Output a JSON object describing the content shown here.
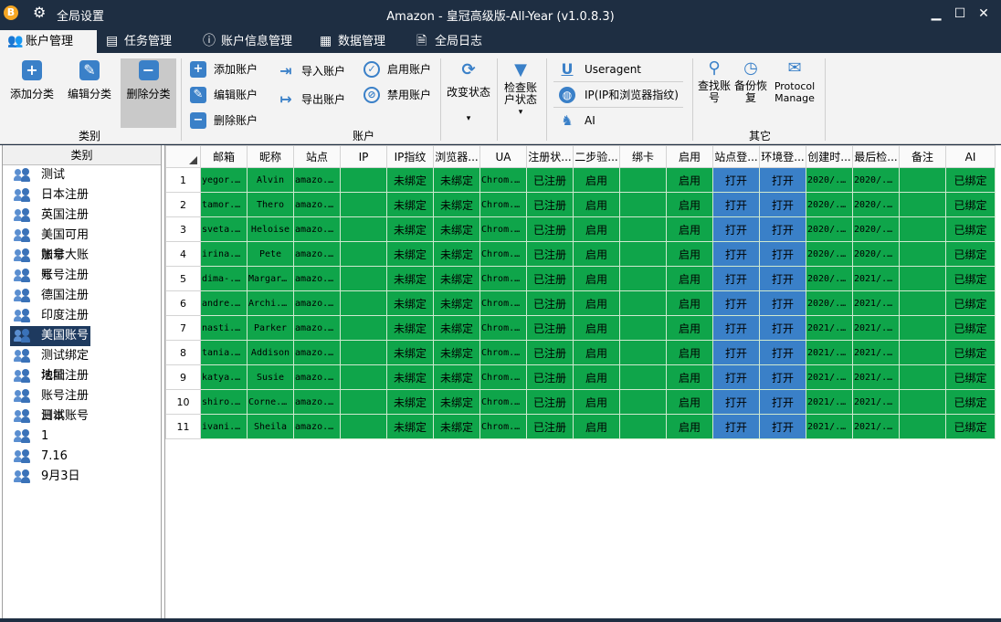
{
  "titlebar": {
    "logo": "B",
    "settings_label": "全局设置",
    "title": "Amazon - 皇冠高级版-All-Year  (v1.0.8.3)"
  },
  "tabs": [
    {
      "label": "账户管理",
      "icon": "users-icon"
    },
    {
      "label": "任务管理",
      "icon": "list-icon"
    },
    {
      "label": "账户信息管理",
      "icon": "info-icon"
    },
    {
      "label": "数据管理",
      "icon": "grid-icon"
    },
    {
      "label": "全局日志",
      "icon": "document-icon"
    }
  ],
  "ribbon": {
    "category_group": {
      "label": "类别",
      "add": "添加分类",
      "edit": "编辑分类",
      "delete": "删除分类"
    },
    "account_group": {
      "label": "账户",
      "add": "添加账户",
      "edit": "编辑账户",
      "delete": "删除账户",
      "import": "导入账户",
      "export": "导出账户",
      "enable": "启用账户",
      "disable": "禁用账户",
      "change_status": "改变状态",
      "check_status": "检查账户状态"
    },
    "other_group": {
      "label": "其它",
      "useragent": "Useragent",
      "ip": "IP(IP和浏览器指纹)",
      "ai": "AI",
      "find": "查找账号",
      "backup": "备份恢复",
      "protocol": "Protocol Manage"
    }
  },
  "sidebar": {
    "header": "类别",
    "selected_index": 8,
    "items": [
      "测试",
      "日本注册",
      "英国注册",
      "美国可用账号",
      "加拿大账号",
      "账号注册",
      "德国注册",
      "印度注册",
      "美国账号2",
      "测试绑定地址",
      "法国注册",
      "账号注册测试",
      "日本账号",
      "1",
      "7.16",
      "9月3日"
    ]
  },
  "table": {
    "columns": [
      "邮箱",
      "昵称",
      "站点",
      "IP",
      "IP指纹",
      "浏览器...",
      "UA",
      "注册状...",
      "二步验...",
      "绑卡",
      "启用",
      "站点登...",
      "环境登...",
      "创建时...",
      "最后检...",
      "备注",
      "AI"
    ],
    "rows": [
      {
        "n": "1",
        "email": "yegor...",
        "nick": "Alvin",
        "site": "amazo...",
        "ip": "",
        "fp": "未绑定",
        "browser": "未绑定",
        "ua": "Chrom...",
        "reg": "已注册",
        "twofa": "启用",
        "card": "",
        "enabled": "启用",
        "site_login": "打开",
        "env_login": "打开",
        "created": "2020/...",
        "last": "2020/...",
        "note": "",
        "ai": "已绑定"
      },
      {
        "n": "2",
        "email": "tamor...",
        "nick": "Thero",
        "site": "amazo...",
        "ip": "",
        "fp": "未绑定",
        "browser": "未绑定",
        "ua": "Chrom...",
        "reg": "已注册",
        "twofa": "启用",
        "card": "",
        "enabled": "启用",
        "site_login": "打开",
        "env_login": "打开",
        "created": "2020/...",
        "last": "2020/...",
        "note": "",
        "ai": "已绑定"
      },
      {
        "n": "3",
        "email": "sveta...",
        "nick": "Heloise",
        "site": "amazo...",
        "ip": "",
        "fp": "未绑定",
        "browser": "未绑定",
        "ua": "Chrom...",
        "reg": "已注册",
        "twofa": "启用",
        "card": "",
        "enabled": "启用",
        "site_login": "打开",
        "env_login": "打开",
        "created": "2020/...",
        "last": "2020/...",
        "note": "",
        "ai": "已绑定"
      },
      {
        "n": "4",
        "email": "irina...",
        "nick": "Pete",
        "site": "amazo...",
        "ip": "",
        "fp": "未绑定",
        "browser": "未绑定",
        "ua": "Chrom...",
        "reg": "已注册",
        "twofa": "启用",
        "card": "",
        "enabled": "启用",
        "site_login": "打开",
        "env_login": "打开",
        "created": "2020/...",
        "last": "2020/...",
        "note": "",
        "ai": "已绑定"
      },
      {
        "n": "5",
        "email": "dima-...",
        "nick": "Margaret",
        "site": "amazo...",
        "ip": "",
        "fp": "未绑定",
        "browser": "未绑定",
        "ua": "Chrom...",
        "reg": "已注册",
        "twofa": "启用",
        "card": "",
        "enabled": "启用",
        "site_login": "打开",
        "env_login": "打开",
        "created": "2020/...",
        "last": "2021/...",
        "note": "",
        "ai": "已绑定"
      },
      {
        "n": "6",
        "email": "andre...",
        "nick": "Archi...",
        "site": "amazo...",
        "ip": "",
        "fp": "未绑定",
        "browser": "未绑定",
        "ua": "Chrom...",
        "reg": "已注册",
        "twofa": "启用",
        "card": "",
        "enabled": "启用",
        "site_login": "打开",
        "env_login": "打开",
        "created": "2020/...",
        "last": "2021/...",
        "note": "",
        "ai": "已绑定"
      },
      {
        "n": "7",
        "email": "nasti...",
        "nick": "Parker",
        "site": "amazo...",
        "ip": "",
        "fp": "未绑定",
        "browser": "未绑定",
        "ua": "Chrom...",
        "reg": "已注册",
        "twofa": "启用",
        "card": "",
        "enabled": "启用",
        "site_login": "打开",
        "env_login": "打开",
        "created": "2021/...",
        "last": "2021/...",
        "note": "",
        "ai": "已绑定"
      },
      {
        "n": "8",
        "email": "tania...",
        "nick": "Addison",
        "site": "amazo...",
        "ip": "",
        "fp": "未绑定",
        "browser": "未绑定",
        "ua": "Chrom...",
        "reg": "已注册",
        "twofa": "启用",
        "card": "",
        "enabled": "启用",
        "site_login": "打开",
        "env_login": "打开",
        "created": "2021/...",
        "last": "2021/...",
        "note": "",
        "ai": "已绑定"
      },
      {
        "n": "9",
        "email": "katya...",
        "nick": "Susie",
        "site": "amazo...",
        "ip": "",
        "fp": "未绑定",
        "browser": "未绑定",
        "ua": "Chrom...",
        "reg": "已注册",
        "twofa": "启用",
        "card": "",
        "enabled": "启用",
        "site_login": "打开",
        "env_login": "打开",
        "created": "2021/...",
        "last": "2021/...",
        "note": "",
        "ai": "已绑定"
      },
      {
        "n": "10",
        "email": "shiro...",
        "nick": "Corne...",
        "site": "amazo...",
        "ip": "",
        "fp": "未绑定",
        "browser": "未绑定",
        "ua": "Chrom...",
        "reg": "已注册",
        "twofa": "启用",
        "card": "",
        "enabled": "启用",
        "site_login": "打开",
        "env_login": "打开",
        "created": "2021/...",
        "last": "2021/...",
        "note": "",
        "ai": "已绑定"
      },
      {
        "n": "11",
        "email": "ivani...",
        "nick": "Sheila",
        "site": "amazo...",
        "ip": "",
        "fp": "未绑定",
        "browser": "未绑定",
        "ua": "Chrom...",
        "reg": "已注册",
        "twofa": "启用",
        "card": "",
        "enabled": "启用",
        "site_login": "打开",
        "env_login": "打开",
        "created": "2021/...",
        "last": "2021/...",
        "note": "",
        "ai": "已绑定"
      }
    ]
  },
  "colors": {
    "titlebar_bg": "#1e2e42",
    "row_green": "#0fa54a",
    "open_blue": "#3a80c8",
    "accent_blue": "#3a80c8"
  }
}
